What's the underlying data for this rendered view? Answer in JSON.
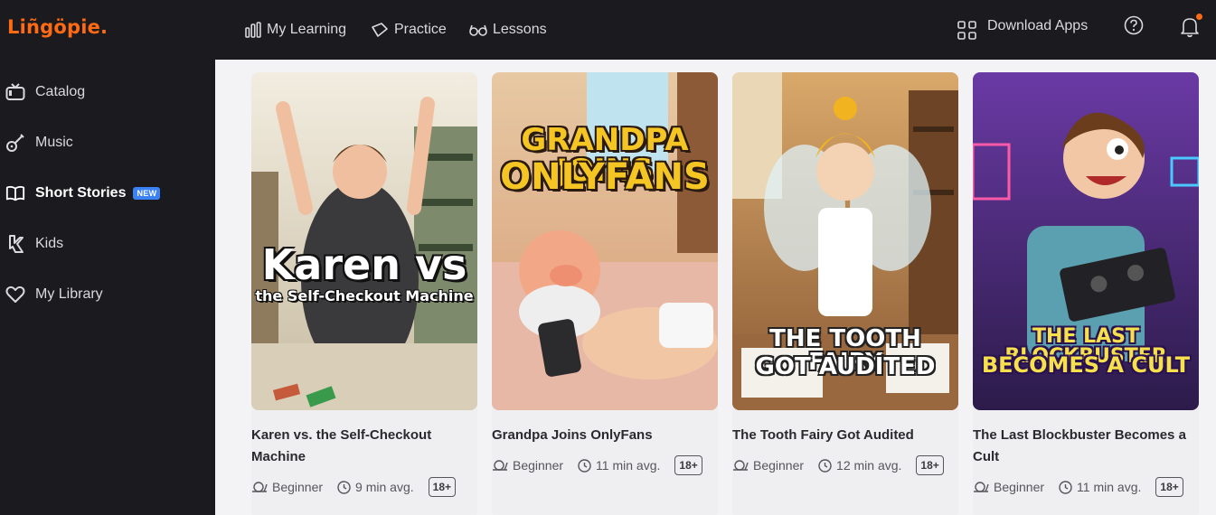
{
  "app": {
    "logo": "Liñgöpie."
  },
  "sidebar": {
    "items": [
      {
        "label": "Catalog",
        "icon": "tv-icon"
      },
      {
        "label": "Music",
        "icon": "guitar-icon"
      },
      {
        "label": "Short Stories",
        "icon": "book-open-icon",
        "badge": "NEW",
        "active": true
      },
      {
        "label": "Kids",
        "icon": "kids-icon"
      },
      {
        "label": "My Library",
        "icon": "heart-icon"
      }
    ]
  },
  "topbar": {
    "nav": [
      {
        "label": "My Learning",
        "icon": "bar-chart-icon"
      },
      {
        "label": "Practice",
        "icon": "cards-icon"
      },
      {
        "label": "Lessons",
        "icon": "glasses-icon"
      }
    ],
    "download_label": "Download Apps"
  },
  "stories": [
    {
      "title": "Karen vs. the Self-Checkout Machine",
      "poster_line1": "Karen vs",
      "poster_line2": "the Self-Checkout Machine",
      "level": "Beginner",
      "duration": "9 min avg.",
      "age": "18+",
      "colors": {
        "bg": "#c9c0a6",
        "accent": "#3d3b3e"
      }
    },
    {
      "title": "Grandpa Joins OnlyFans",
      "poster_line1": "GRANDPA JOINS",
      "poster_line2": "ONLYFANS",
      "level": "Beginner",
      "duration": "11 min avg.",
      "age": "18+",
      "colors": {
        "bg": "#f0c89a",
        "accent": "#f5c623"
      }
    },
    {
      "title": "The Tooth Fairy Got Audited",
      "poster_line1": "THE TOOTH FAIRY",
      "poster_line2": "GOT AUDITED",
      "level": "Beginner",
      "duration": "12 min avg.",
      "age": "18+",
      "colors": {
        "bg": "#b98c5e",
        "accent": "#ffffff"
      }
    },
    {
      "title": "The Last Blockbuster Becomes a Cult",
      "poster_line1": "THE LAST BLOCKBUSTER",
      "poster_line2": "BECOMES A CULT",
      "level": "Beginner",
      "duration": "11 min avg.",
      "age": "18+",
      "colors": {
        "bg": "#4a2a78",
        "accent": "#f6e04b"
      }
    }
  ]
}
